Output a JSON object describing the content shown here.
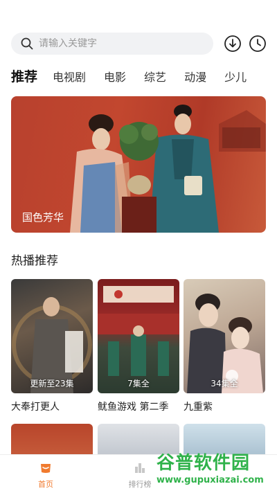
{
  "search": {
    "placeholder": "请输入关键字"
  },
  "tabs": [
    "推荐",
    "电视剧",
    "电影",
    "综艺",
    "动漫",
    "少儿"
  ],
  "banner": {
    "title": "国色芳华"
  },
  "section": {
    "title": "热播推荐"
  },
  "posters": [
    {
      "title": "大奉打更人",
      "badge": "更新至23集"
    },
    {
      "title": "鱿鱼游戏 第二季",
      "badge": "7集全"
    },
    {
      "title": "九重紫",
      "badge": "34集全"
    }
  ],
  "tabbar": {
    "home": "首页",
    "rank": "排行榜"
  },
  "watermark": {
    "title": "谷普软件园",
    "url": "www.gupuxiazai.com"
  },
  "colors": {
    "accent": "#f07a2e",
    "watermark": "#2fb24a"
  }
}
